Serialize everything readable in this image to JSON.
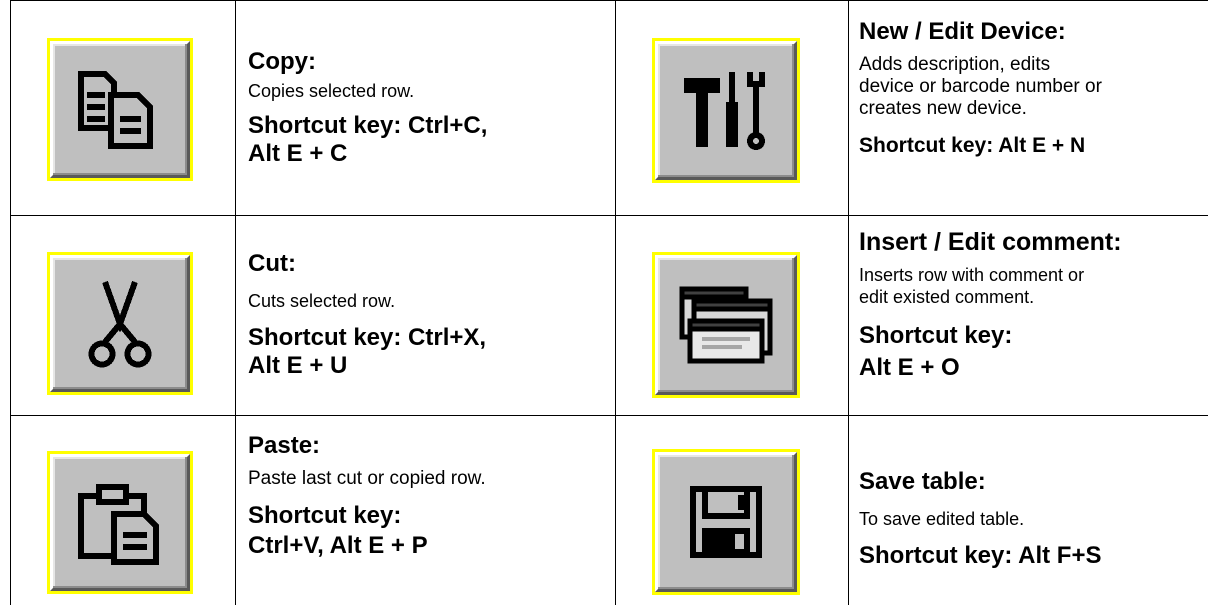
{
  "rows": [
    {
      "left": {
        "icon": "copy-icon",
        "title": "Copy:",
        "description": "Copies selected row.",
        "shortcut_line1": "Shortcut key: Ctrl+C,",
        "shortcut_line2": "Alt E + C"
      },
      "right": {
        "icon": "tools-icon",
        "title": "New / Edit Device:",
        "description_line1": "Adds description, edits",
        "description_line2": "device  or barcode number or",
        "description_line3": "creates new device.",
        "shortcut": "Shortcut key: Alt E + N"
      }
    },
    {
      "left": {
        "icon": "scissors-icon",
        "title": "Cut:",
        "description": "Cuts selected row.",
        "shortcut_line1": "Shortcut key: Ctrl+X,",
        "shortcut_line2": "Alt E + U"
      },
      "right": {
        "icon": "comment-icon",
        "title": "Insert / Edit comment:",
        "description_line1": "Inserts row with comment or",
        "description_line2": "edit existed comment.",
        "shortcut_line1": "Shortcut key:",
        "shortcut_line2": "Alt E + O"
      }
    },
    {
      "left": {
        "icon": "paste-icon",
        "title": "Paste:",
        "description": "Paste last cut or copied row.",
        "shortcut_line1": "Shortcut key:",
        "shortcut_line2": "Ctrl+V, Alt E + P"
      },
      "right": {
        "icon": "floppy-disk-icon",
        "title": "Save table:",
        "description": "To save edited table.",
        "shortcut": "Shortcut key: Alt F+S"
      }
    }
  ],
  "colors": {
    "highlight": "#ffff00",
    "button_face": "#bfbfbf",
    "grid": "#000000"
  }
}
